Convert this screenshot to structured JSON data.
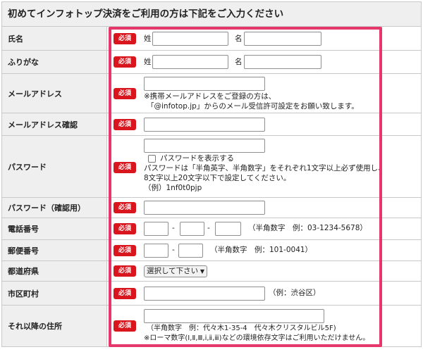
{
  "header": {
    "title": "初めてインフォトップ決済をご利用の方は下記をご入力ください"
  },
  "required_badge": "必須",
  "rows": {
    "name": {
      "label": "氏名",
      "sei_label": "姓",
      "mei_label": "名",
      "sei_value": "",
      "mei_value": ""
    },
    "furigana": {
      "label": "ふりがな",
      "sei_label": "姓",
      "mei_label": "名",
      "sei_value": "",
      "mei_value": ""
    },
    "email": {
      "label": "メールアドレス",
      "value": "",
      "note1": "※携帯メールアドレスをご登録の方は、",
      "note2": "「@infotop.jp」からのメール受信許可設定をお願い致します。"
    },
    "email_confirm": {
      "label": "メールアドレス確認",
      "value": ""
    },
    "password": {
      "label": "パスワード",
      "value": "",
      "show_label": "パスワードを表示する",
      "show_checked": false,
      "rule1": "パスワードは「半角英字、半角数字」をそれぞれ1文字以上必ず使用し、",
      "rule2": "8文字以上20文字以下で設定してください。",
      "example": "（例）1nf0t0pjp"
    },
    "password_confirm": {
      "label": "パスワード（確認用）",
      "value": ""
    },
    "phone": {
      "label": "電話番号",
      "sep": "-",
      "hint": "（半角数字　例：03-1234-5678）"
    },
    "postal": {
      "label": "郵便番号",
      "sep": "-",
      "hint": "（半角数字　例：101-0041）"
    },
    "prefecture": {
      "label": "都道府県",
      "selected": "選択して下さい"
    },
    "city": {
      "label": "市区町村",
      "value": "",
      "hint": "（例：渋谷区）"
    },
    "address": {
      "label": "それ以降の住所",
      "value": "",
      "hint1": "（半角数字　例：代々木1-35-4　代々木クリスタルビル5F)",
      "hint2": "※ローマ数字(Ⅰ,Ⅱ,Ⅲ,ⅰ,ⅱ,ⅲ)などの環境依存文字はご利用いただけません。"
    }
  },
  "colors": {
    "required_badge": "#d9161d",
    "highlight_border": "#e5376a",
    "label_bg": "#efefef",
    "border": "#c9c9c9"
  },
  "icons": {
    "select_arrow": "chevron-down-icon"
  }
}
